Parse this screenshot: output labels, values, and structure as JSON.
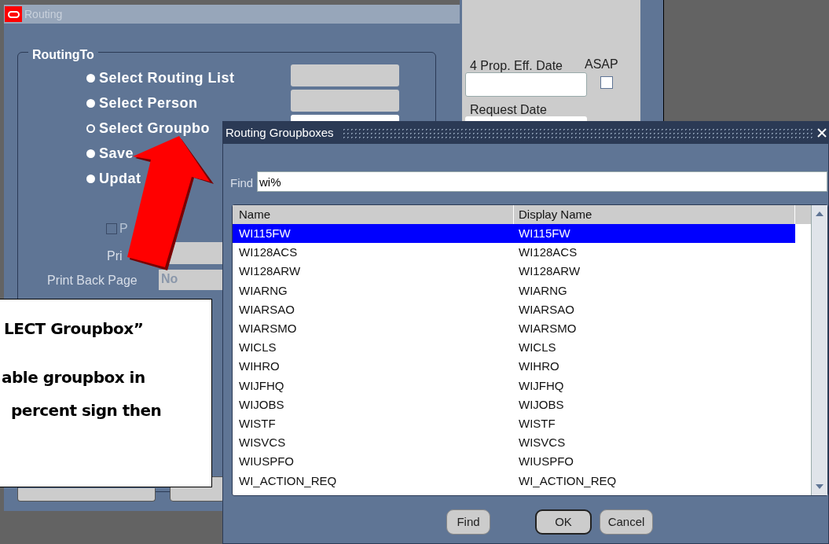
{
  "main_window": {
    "title": "Routing",
    "group": {
      "label": "RoutingTo",
      "options": [
        {
          "label": "Select Routing List",
          "selected": false,
          "field_enabled": false
        },
        {
          "label": "Select Person",
          "selected": false,
          "field_enabled": false
        },
        {
          "label": "Select Groupbo",
          "selected": true,
          "field_enabled": true
        },
        {
          "label": "Save",
          "selected": false
        },
        {
          "label": "Updat",
          "selected": false
        }
      ],
      "checkbox": {
        "label": "P",
        "checked": false
      },
      "print_label": "Pri",
      "print_back_page": {
        "label": "Print Back Page",
        "value": "No"
      }
    }
  },
  "side_panel": {
    "prop_eff_date": {
      "label": "4 Prop. Eff. Date"
    },
    "asap": {
      "label": "ASAP",
      "checked": false
    },
    "request_date": {
      "label": "Request Date"
    }
  },
  "dialog": {
    "title": "Routing Groupboxes",
    "find": {
      "label": "Find",
      "value": "wi%"
    },
    "columns": [
      "Name",
      "Display Name"
    ],
    "rows": [
      {
        "name": "WI115FW",
        "display_name": "WI115FW",
        "selected": true
      },
      {
        "name": "WI128ACS",
        "display_name": "WI128ACS",
        "selected": false
      },
      {
        "name": "WI128ARW",
        "display_name": "WI128ARW",
        "selected": false
      },
      {
        "name": "WIARNG",
        "display_name": "WIARNG",
        "selected": false
      },
      {
        "name": "WIARSAO",
        "display_name": "WIARSAO",
        "selected": false
      },
      {
        "name": "WIARSMO",
        "display_name": "WIARSMO",
        "selected": false
      },
      {
        "name": "WICLS",
        "display_name": "WICLS",
        "selected": false
      },
      {
        "name": "WIHRO",
        "display_name": "WIHRO",
        "selected": false
      },
      {
        "name": "WIJFHQ",
        "display_name": "WIJFHQ",
        "selected": false
      },
      {
        "name": "WIJOBS",
        "display_name": "WIJOBS",
        "selected": false
      },
      {
        "name": "WISTF",
        "display_name": "WISTF",
        "selected": false
      },
      {
        "name": "WISVCS",
        "display_name": "WISVCS",
        "selected": false
      },
      {
        "name": "WIUSPFO",
        "display_name": "WIUSPFO",
        "selected": false
      },
      {
        "name": "WI_ACTION_REQ",
        "display_name": "WI_ACTION_REQ",
        "selected": false
      }
    ],
    "buttons": [
      {
        "label": "Find",
        "default": false
      },
      {
        "label": "OK",
        "default": true
      },
      {
        "label": "Cancel",
        "default": false
      }
    ]
  },
  "callout": {
    "lines": [
      "LECT Groupbox”",
      "able groupbox in",
      "percent sign then"
    ]
  }
}
